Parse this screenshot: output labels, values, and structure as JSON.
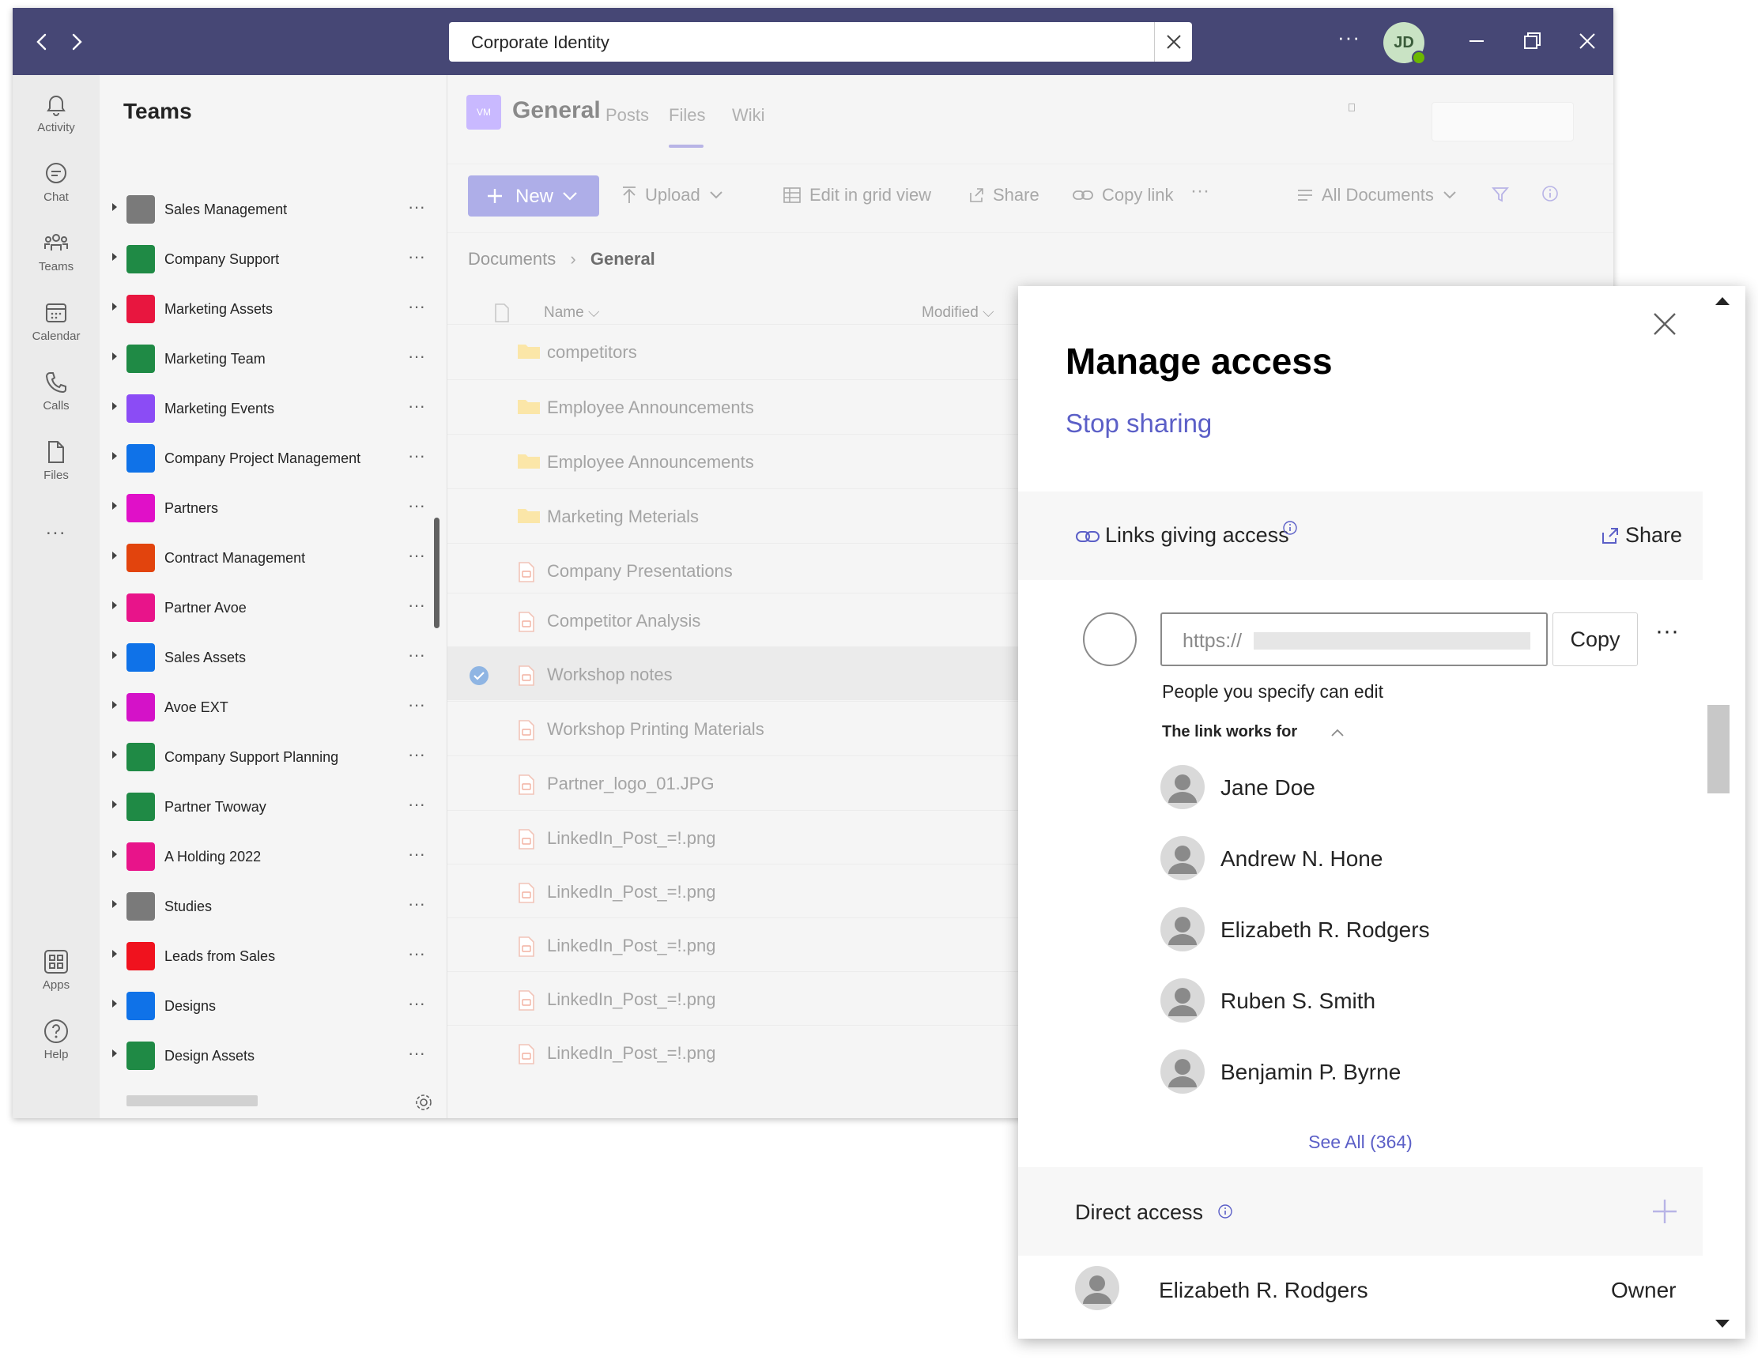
{
  "titlebar": {
    "search_value": "Corporate Identity",
    "more": "···",
    "avatar_initials": "JD"
  },
  "rail": {
    "items": [
      {
        "label": "Activity",
        "icon": "bell-icon"
      },
      {
        "label": "Chat",
        "icon": "chat-icon"
      },
      {
        "label": "Teams",
        "icon": "teams-icon"
      },
      {
        "label": "Calendar",
        "icon": "calendar-icon"
      },
      {
        "label": "Calls",
        "icon": "phone-icon"
      },
      {
        "label": "Files",
        "icon": "file-icon"
      },
      {
        "label": "...",
        "icon": "more-icon"
      },
      {
        "label": "Apps",
        "icon": "apps-icon"
      },
      {
        "label": "Help",
        "icon": "help-icon"
      }
    ]
  },
  "teams_panel": {
    "title": "Teams",
    "more": "···",
    "teams": [
      {
        "name": "Sales Management",
        "color": "#7a7a7a"
      },
      {
        "name": "Company Support",
        "color": "#1f8a45"
      },
      {
        "name": "Marketing Assets",
        "color": "#e8163f"
      },
      {
        "name": "Marketing Team",
        "color": "#1f8a45"
      },
      {
        "name": "Marketing Events",
        "color": "#8b4cf5"
      },
      {
        "name": "Company Project Management",
        "color": "#0f72e8"
      },
      {
        "name": "Partners",
        "color": "#e010c8"
      },
      {
        "name": "Contract Management",
        "color": "#e2440d"
      },
      {
        "name": "Partner  Avoe",
        "color": "#e8148a"
      },
      {
        "name": "Sales Assets",
        "color": "#0f72e8"
      },
      {
        "name": "Avoe EXT",
        "color": "#d412c8"
      },
      {
        "name": "Company Support Planning",
        "color": "#1f8a45"
      },
      {
        "name": "Partner Twoway",
        "color": "#1f8a45"
      },
      {
        "name": "A Holding 2022",
        "color": "#e8148a"
      },
      {
        "name": "Studies",
        "color": "#7a7a7a"
      },
      {
        "name": "Leads from Sales",
        "color": "#f0121e"
      },
      {
        "name": "Designs",
        "color": "#0f72e8"
      },
      {
        "name": "Design Assets",
        "color": "#1f8a45"
      }
    ]
  },
  "channel": {
    "avatar": "VM",
    "name": "General",
    "tabs": [
      "Posts",
      "Files",
      "Wiki"
    ]
  },
  "toolbar": {
    "new": "New",
    "upload": "Upload",
    "grid": "Edit in grid view",
    "share": "Share",
    "copy_link": "Copy link",
    "more": "···",
    "view": "All Documents"
  },
  "breadcrumb": {
    "root": "Documents",
    "current": "General"
  },
  "files": {
    "col_name": "Name",
    "col_modified": "Modified",
    "rows": [
      {
        "name": "competitors",
        "type": "folder"
      },
      {
        "name": "Employee Announcements",
        "type": "folder"
      },
      {
        "name": "Employee Announcements",
        "type": "folder"
      },
      {
        "name": "Marketing Meterials",
        "type": "folder"
      },
      {
        "name": "Company Presentations",
        "type": "file"
      },
      {
        "name": "Competitor Analysis",
        "type": "file"
      },
      {
        "name": "Workshop notes",
        "type": "file",
        "selected": true
      },
      {
        "name": "Workshop Printing Materials",
        "type": "file"
      },
      {
        "name": "Partner_logo_01.JPG",
        "type": "file"
      },
      {
        "name": "LinkedIn_Post_=!.png",
        "type": "file"
      },
      {
        "name": "LinkedIn_Post_=!.png",
        "type": "file"
      },
      {
        "name": "LinkedIn_Post_=!.png",
        "type": "file"
      },
      {
        "name": "LinkedIn_Post_=!.png",
        "type": "file"
      },
      {
        "name": "LinkedIn_Post_=!.png",
        "type": "file"
      }
    ]
  },
  "manage_access": {
    "title": "Manage access",
    "stop_sharing": "Stop sharing",
    "links_label": "Links giving access",
    "share": "Share",
    "url_prefix": "https://",
    "copy": "Copy",
    "more": "···",
    "link_desc": "People you specify can edit",
    "link_works_for": "The link works for",
    "people": [
      "Jane Doe",
      "Andrew N. Hone",
      "Elizabeth R. Rodgers",
      "Ruben S. Smith",
      "Benjamin P. Byrne"
    ],
    "see_all": "See All (364)",
    "direct_access": "Direct access",
    "owner_name": "Elizabeth R. Rodgers",
    "owner_role": "Owner",
    "accent": "#5b5fc7"
  }
}
